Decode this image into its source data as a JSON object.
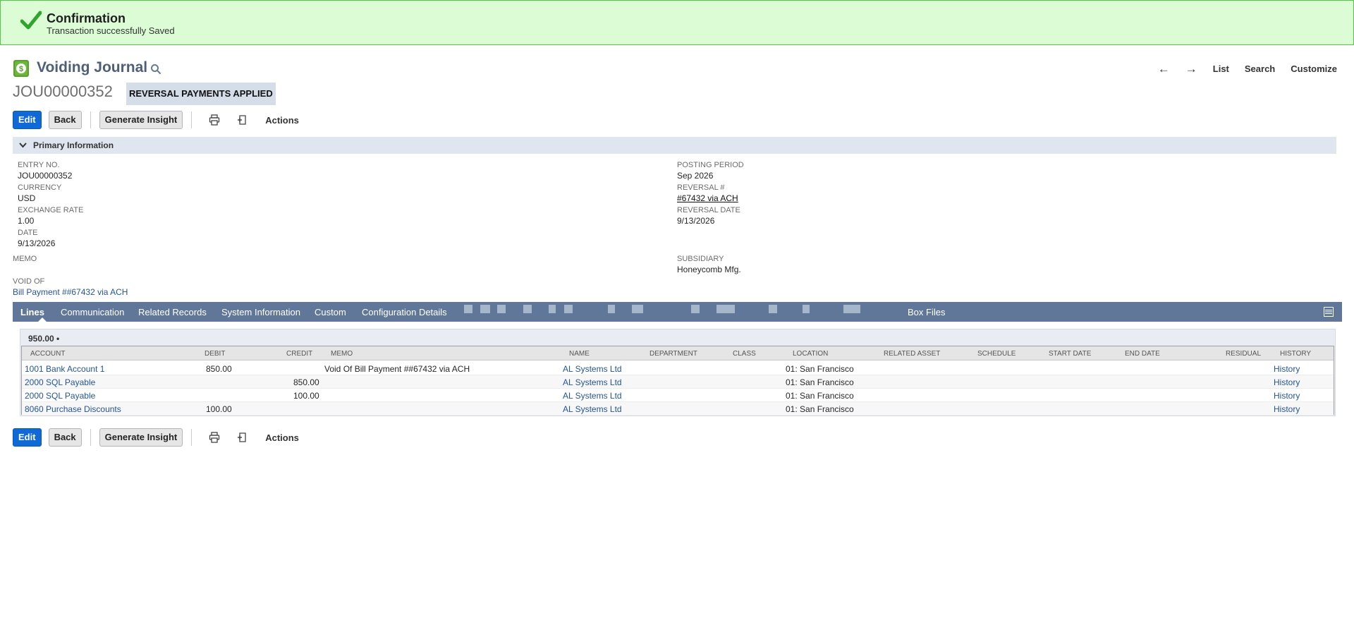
{
  "confirmation": {
    "title": "Confirmation",
    "message": "Transaction successfully Saved"
  },
  "record": {
    "type_title": "Voiding Journal",
    "id": "JOU00000352",
    "status": "REVERSAL PAYMENTS APPLIED"
  },
  "nav": {
    "prev": "←",
    "next": "→",
    "list": "List",
    "search": "Search",
    "customize": "Customize"
  },
  "toolbar": {
    "edit": "Edit",
    "back": "Back",
    "generate_insight": "Generate Insight",
    "actions": "Actions"
  },
  "primary_section": {
    "title": "Primary Information"
  },
  "fields_left": [
    {
      "label": "ENTRY NO.",
      "value": "JOU00000352"
    },
    {
      "label": "CURRENCY",
      "value": "USD"
    },
    {
      "label": "EXCHANGE RATE",
      "value": "1.00"
    },
    {
      "label": "DATE",
      "value": "9/13/2026"
    },
    {
      "label": "MEMO",
      "value": ""
    },
    {
      "label": "VOID OF",
      "value": "Bill Payment ##67432 via ACH"
    }
  ],
  "fields_right": [
    {
      "label": "POSTING PERIOD",
      "value": "Sep 2026"
    },
    {
      "label": "REVERSAL #",
      "value": "#67432 via ACH"
    },
    {
      "label": "REVERSAL DATE",
      "value": "9/13/2026"
    },
    {
      "label": "SUBSIDIARY",
      "value": "Honeycomb Mfg."
    }
  ],
  "tabs": [
    "Lines",
    "Communication",
    "Related Records",
    "System Information",
    "Custom",
    "Configuration Details",
    "Box Files"
  ],
  "lines": {
    "total": "950.00 •",
    "columns": [
      "ACCOUNT",
      "DEBIT",
      "CREDIT",
      "MEMO",
      "NAME",
      "DEPARTMENT",
      "CLASS",
      "LOCATION",
      "RELATED ASSET",
      "SCHEDULE",
      "START DATE",
      "END DATE",
      "RESIDUAL",
      "HISTORY"
    ],
    "rows": [
      {
        "account": "1001 Bank Account 1",
        "debit": "850.00",
        "credit": "",
        "memo": "Void Of Bill Payment ##67432 via ACH",
        "name": "AL Systems Ltd",
        "location": "01: San Francisco",
        "history": "History"
      },
      {
        "account": "2000 SQL Payable",
        "debit": "",
        "credit": "850.00",
        "memo": "",
        "name": "AL Systems Ltd",
        "location": "01: San Francisco",
        "history": "History"
      },
      {
        "account": "2000 SQL Payable",
        "debit": "",
        "credit": "100.00",
        "memo": "",
        "name": "AL Systems Ltd",
        "location": "01: San Francisco",
        "history": "History"
      },
      {
        "account": "8060 Purchase Discounts",
        "debit": "100.00",
        "credit": "",
        "memo": "",
        "name": "AL Systems Ltd",
        "location": "01: San Francisco",
        "history": "History"
      }
    ]
  },
  "colors": {
    "confirm_bg": "#dbfcd5",
    "primary_button": "#0f6ad8",
    "tab_bar": "#607799",
    "link": "#255599"
  }
}
